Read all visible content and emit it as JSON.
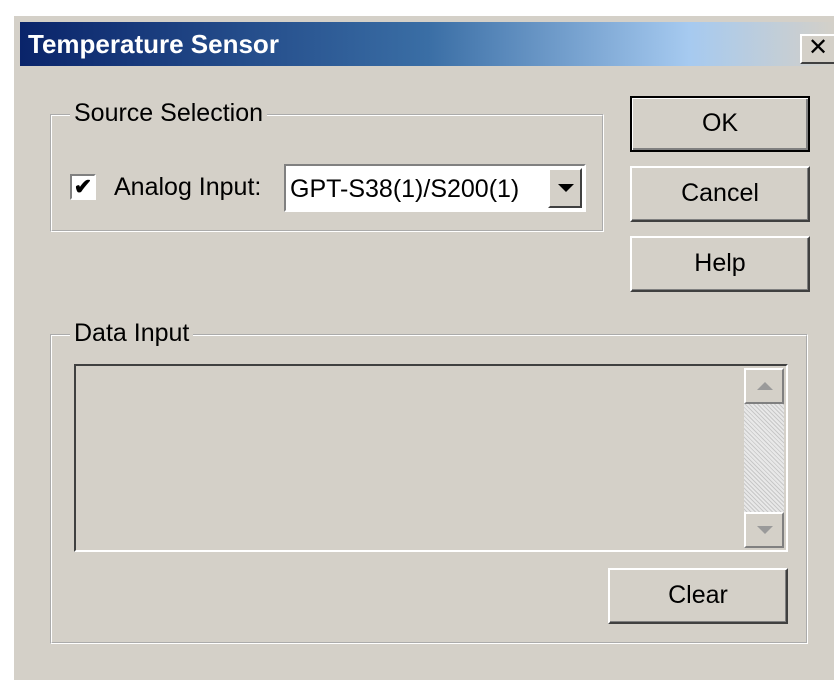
{
  "window": {
    "title": "Temperature Sensor",
    "close_glyph": "✕"
  },
  "source_selection": {
    "legend": "Source Selection",
    "analog_checked": true,
    "check_glyph": "✔",
    "analog_label": "Analog Input:",
    "analog_value": "GPT-S38(1)/S200(1)"
  },
  "buttons": {
    "ok": "OK",
    "cancel": "Cancel",
    "help": "Help",
    "clear": "Clear"
  },
  "data_input": {
    "legend": "Data Input",
    "text": ""
  },
  "icons": {
    "close": "close-icon",
    "combo_arrow": "chevron-down-icon",
    "scroll_up": "scroll-up-arrow-icon",
    "scroll_down": "scroll-down-arrow-icon"
  },
  "colors": {
    "face": "#d4d0c8",
    "title_start": "#0a246a",
    "title_end": "#d4d0c8"
  }
}
